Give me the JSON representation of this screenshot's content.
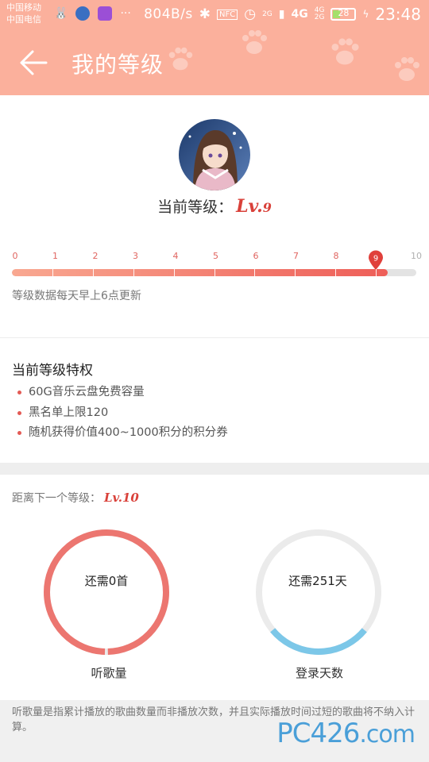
{
  "status_bar": {
    "carrier_1": "中国移动",
    "carrier_2": "中国电信",
    "net_speed": "804B/s",
    "nfc": "NFC",
    "signal_1": "2G",
    "signal_2": "4G",
    "signal_3": "4G",
    "signal_4": "2G",
    "battery": "28",
    "time": "23:48"
  },
  "header": {
    "title": "我的等级"
  },
  "profile": {
    "level_label": "当前等级：",
    "level_prefix": "Lv.",
    "level_value": "9"
  },
  "progress": {
    "ticks": [
      "0",
      "1",
      "2",
      "3",
      "4",
      "5",
      "6",
      "7",
      "8",
      "9",
      "10"
    ],
    "current_level": 9,
    "max_level": 10,
    "fill_fraction": 0.93,
    "note": "等级数据每天早上6点更新"
  },
  "privileges": {
    "title": "当前等级特权",
    "items": [
      "60G音乐云盘免费容量",
      "黑名单上限120",
      "随机获得价值400~1000积分的积分券"
    ]
  },
  "next_level": {
    "label": "距离下一个等级：",
    "level": "Lv.10",
    "songs": {
      "text": "还需0首",
      "caption": "听歌量",
      "progress": 1.0
    },
    "days": {
      "text": "还需251天",
      "caption": "登录天数",
      "progress": 0.28
    }
  },
  "footer": {
    "note": "听歌量是指累计播放的歌曲数量而非播放次数，并且实际播放时间过短的歌曲将不纳入计算。",
    "watermark_main": "PC426",
    "watermark_suffix": ".com"
  },
  "colors": {
    "accent": "#fbb09c",
    "level_red": "#d9413a",
    "ring_red": "#ec7670",
    "ring_blue": "#7cc7e8",
    "ring_bg": "#ebebeb"
  }
}
